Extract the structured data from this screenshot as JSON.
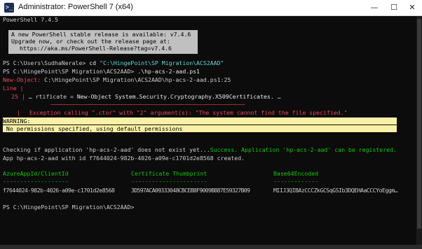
{
  "window": {
    "title": "Administrator: PowerShell 7 (x64)",
    "icon": "powershell-icon",
    "controls": {
      "minimize": "—",
      "maximize": "☐",
      "close": "✕"
    }
  },
  "console": {
    "version_line": "PowerShell 7.4.5",
    "update_notice": [
      "A new PowerShell stable release is available: v7.4.6",
      "Upgrade now, or check out the release page at:",
      "https://aka.ms/PowerShell-Release?tag=v7.4.6"
    ],
    "cmd1": {
      "prompt": "PS C:\\Users\\SudhaNerale> ",
      "command": "cd ",
      "arg": "\"C:\\HingePoint\\SP Migration\\ACS2AAD\""
    },
    "cmd2": {
      "prompt": "PS C:\\HingePoint\\SP Migration\\ACS2AAD> ",
      "command": ".\\hp-acs-2-aad.ps1"
    },
    "error": {
      "location_label": "New-Object: ",
      "location": "C:\\HingePoint\\SP Migration\\ACS2AAD\\hp-acs-2-aad.ps1:25",
      "line_label": "Line |",
      "line_number": "25",
      "code_prefix": "… rtificate = ",
      "code_highlight": "New-Object System.Security.Cryptography.X509Certificates.",
      "code_suffix": " …",
      "underline": "~~~~~~~~~~~~~~~~~~~~~~~~~~~~~~~~~~~~~~~~~~~~~~~~~~~~~~~~~~~~~~~~",
      "message": "Exception calling \".ctor\" with \"2\" argument(s): \"The system cannot find the file specified.\""
    },
    "warning": {
      "label": "WARNING:",
      "text": " No permissions specified, using default permissions"
    },
    "check": {
      "prefix": "Checking if application 'hp-acs-2-aad' does not exist yet...",
      "success": "Success. Application 'hp-acs-2-aad' can be registered."
    },
    "created_line": "App hp-acs-2-aad with id f7644024-982b-4026-a09e-c1701d2e8568 created.",
    "table": {
      "headers": [
        "AzureAppId/ClientId",
        "Certificate Thumbprint",
        "Base64Encoded"
      ],
      "underlines": [
        "-------------------",
        "----------------------",
        "-------------"
      ],
      "row": [
        "f7644024-982b-4026-a09e-c1701d2e8568",
        "3D597ACA09333048CBCEB8F9009B887E59327B09",
        "MIIJ3QIBAzCCCZkGCSqGSIb3DQEHAaCCCYoEggm…"
      ]
    },
    "final_prompt": "PS C:\\HingePoint\\SP Migration\\ACS2AAD> "
  },
  "colors": {
    "background": "#0c0c0c",
    "text": "#cccccc",
    "error_red": "#e74856",
    "success_green": "#16c60c",
    "header_green": "#16c60c",
    "string_cyan": "#61d6d6",
    "warning_bg": "#f9f1a5",
    "warning_text": "#000000",
    "notice_bg": "#c0c0c0"
  }
}
